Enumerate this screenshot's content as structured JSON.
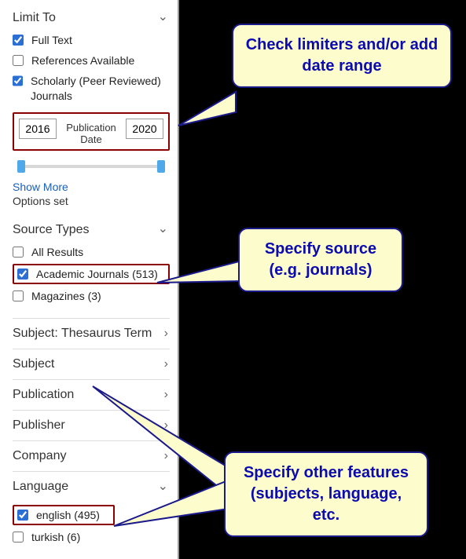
{
  "sections": {
    "limit_to": "Limit To",
    "source_types": "Source Types",
    "subject_thesaurus": "Subject: Thesaurus Term",
    "subject": "Subject",
    "publication": "Publication",
    "publisher": "Publisher",
    "company": "Company",
    "language": "Language"
  },
  "limiters": {
    "full_text": {
      "label": "Full Text",
      "checked": true
    },
    "references": {
      "label": "References Available",
      "checked": false
    },
    "scholarly": {
      "label": "Scholarly (Peer Reviewed) Journals",
      "checked": true
    }
  },
  "date": {
    "from": "2016",
    "to": "2020",
    "label": "Publication Date"
  },
  "show_more": "Show More",
  "options_set": "Options set",
  "source_opts": {
    "all": {
      "label": "All Results",
      "checked": false
    },
    "journals": {
      "label": "Academic Journals (513)",
      "checked": true
    },
    "magazines": {
      "label": "Magazines (3)",
      "checked": false
    }
  },
  "language_opts": {
    "english": {
      "label": "english (495)",
      "checked": true
    },
    "turkish": {
      "label": "turkish (6)",
      "checked": false
    }
  },
  "callouts": {
    "c1": "Check limiters and/or add date range",
    "c2": "Specify source (e.g. journals)",
    "c3": "Specify other features (subjects, language, etc."
  }
}
